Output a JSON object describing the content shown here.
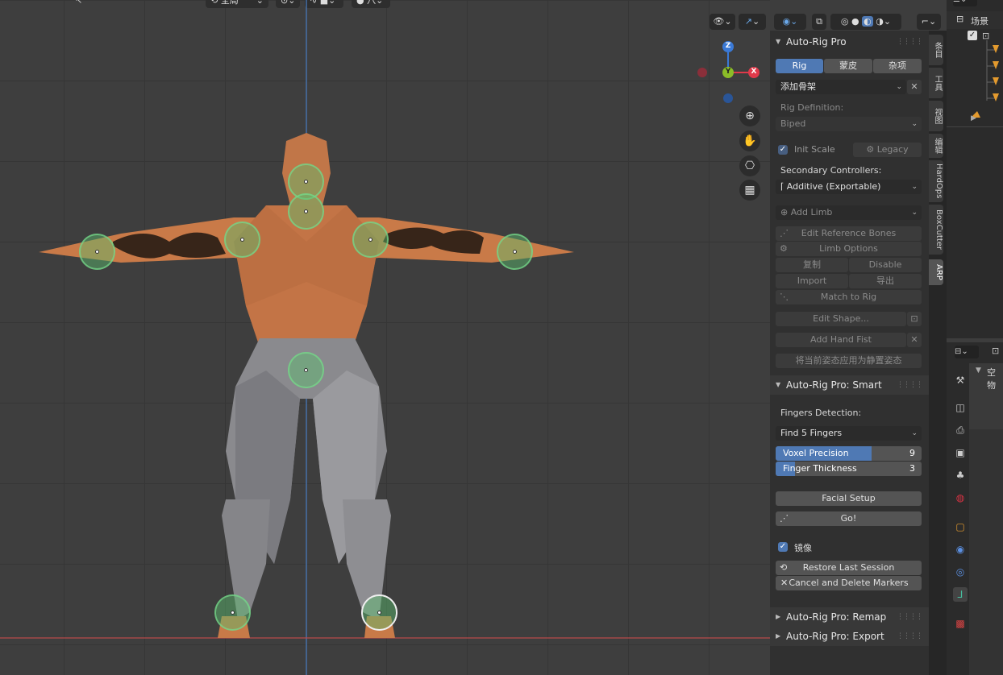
{
  "viewport": {
    "header": {
      "transform_orientation": "全局",
      "options_label": "选项"
    },
    "gizmo": {
      "z": "Z",
      "y": "Y",
      "x": "X"
    },
    "markers": [
      {
        "name": "neck"
      },
      {
        "name": "chin"
      },
      {
        "name": "shoulder-l"
      },
      {
        "name": "shoulder-r"
      },
      {
        "name": "wrist-l"
      },
      {
        "name": "wrist-r"
      },
      {
        "name": "root"
      },
      {
        "name": "foot-l"
      },
      {
        "name": "foot-r"
      }
    ]
  },
  "npanel": {
    "arp_title": "Auto-Rig Pro",
    "tabs": [
      {
        "label": "Rig",
        "active": true
      },
      {
        "label": "蒙皮",
        "active": false
      },
      {
        "label": "杂项",
        "active": false
      }
    ],
    "add_armature": "添加骨架",
    "rig_definition_label": "Rig Definition:",
    "rig_definition_value": "Biped",
    "init_scale": "Init Scale",
    "legacy": "Legacy",
    "secondary_label": "Secondary Controllers:",
    "secondary_value": "Additive (Exportable)",
    "add_limb": "Add Limb",
    "edit_reference_bones": "Edit Reference Bones",
    "limb_options": "Limb Options",
    "copy": "复制",
    "disable": "Disable",
    "import": "Import",
    "export": "导出",
    "match_to_rig": "Match to Rig",
    "edit_shape": "Edit Shape...",
    "add_hand_fist": "Add Hand Fist",
    "apply_pose_rest": "将当前姿态应用为静置姿态",
    "smart_title": "Auto-Rig Pro: Smart",
    "fingers_detection_label": "Fingers Detection:",
    "fingers_detection_value": "Find 5 Fingers",
    "voxel_precision": {
      "label": "Voxel Precision",
      "value": "9",
      "fraction": 0.66
    },
    "finger_thickness": {
      "label": "Finger Thickness",
      "value": "3",
      "fraction": 0.13
    },
    "facial_setup": "Facial Setup",
    "go": "Go!",
    "mirror": "镜像",
    "restore_last_session": "Restore Last Session",
    "cancel_delete_markers": "Cancel and Delete Markers",
    "remap_title": "Auto-Rig Pro: Remap",
    "export_title": "Auto-Rig Pro: Export"
  },
  "side_tabs": [
    "条目",
    "工具",
    "视图",
    "编辑",
    "HardOps",
    "BoxCutter",
    "ARP"
  ],
  "outliner": {
    "scene_label": "场景"
  },
  "properties": {
    "header_label": "空物"
  },
  "colors": {
    "accent": "#4f79b4",
    "marker": "#5abe6e",
    "axis_x": "#e0394a",
    "axis_y": "#8bbd28",
    "axis_z": "#3a79d6"
  }
}
